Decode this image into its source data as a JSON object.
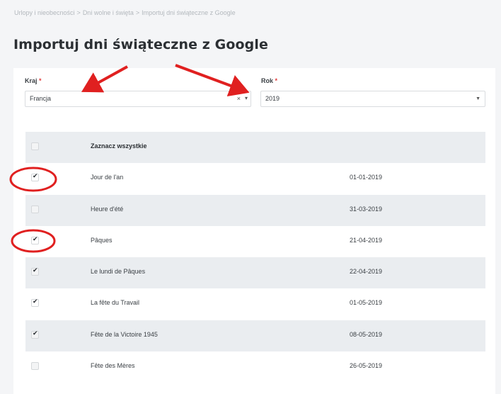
{
  "breadcrumb": {
    "items": [
      "Urlopy i nieobecności",
      "Dni wolne i święta",
      "Importuj dni świąteczne z Google"
    ],
    "separator": ">"
  },
  "page": {
    "title": "Importuj dni świąteczne z Google"
  },
  "form": {
    "country": {
      "label": "Kraj",
      "required_mark": "*",
      "value": "Francja",
      "clear_glyph": "×",
      "caret_glyph": "▾"
    },
    "year": {
      "label": "Rok",
      "required_mark": "*",
      "value": "2019",
      "caret_glyph": "▼"
    }
  },
  "table": {
    "select_all_label": "Zaznacz wszystkie",
    "select_all_checked": false,
    "rows": [
      {
        "name": "Jour de l'an",
        "date": "01-01-2019",
        "checked": true
      },
      {
        "name": "Heure d'été",
        "date": "31-03-2019",
        "checked": false
      },
      {
        "name": "Pâques",
        "date": "21-04-2019",
        "checked": true
      },
      {
        "name": "Le lundi de Pâques",
        "date": "22-04-2019",
        "checked": true
      },
      {
        "name": "La fête du Travail",
        "date": "01-05-2019",
        "checked": true
      },
      {
        "name": "Fête de la Victoire 1945",
        "date": "08-05-2019",
        "checked": true
      },
      {
        "name": "Fête des Mères",
        "date": "26-05-2019",
        "checked": false
      }
    ]
  },
  "annotations": {
    "color": "#e02020"
  },
  "colors": {
    "required": "#e03b3b",
    "row_alt": "#eaedf0",
    "background": "#f4f5f7"
  }
}
